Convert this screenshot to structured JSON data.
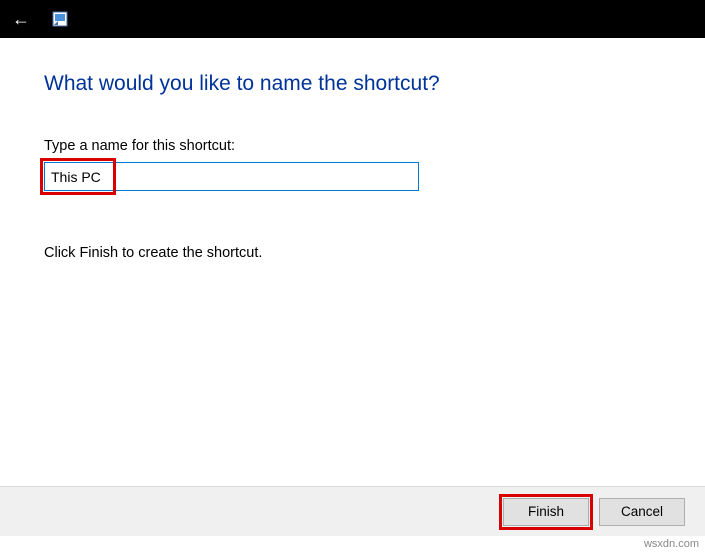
{
  "wizard": {
    "heading": "What would you like to name the shortcut?",
    "label": "Type a name for this shortcut:",
    "input_value": "This PC",
    "instruction": "Click Finish to create the shortcut."
  },
  "buttons": {
    "finish": "Finish",
    "cancel": "Cancel"
  },
  "watermark": "wsxdn.com"
}
